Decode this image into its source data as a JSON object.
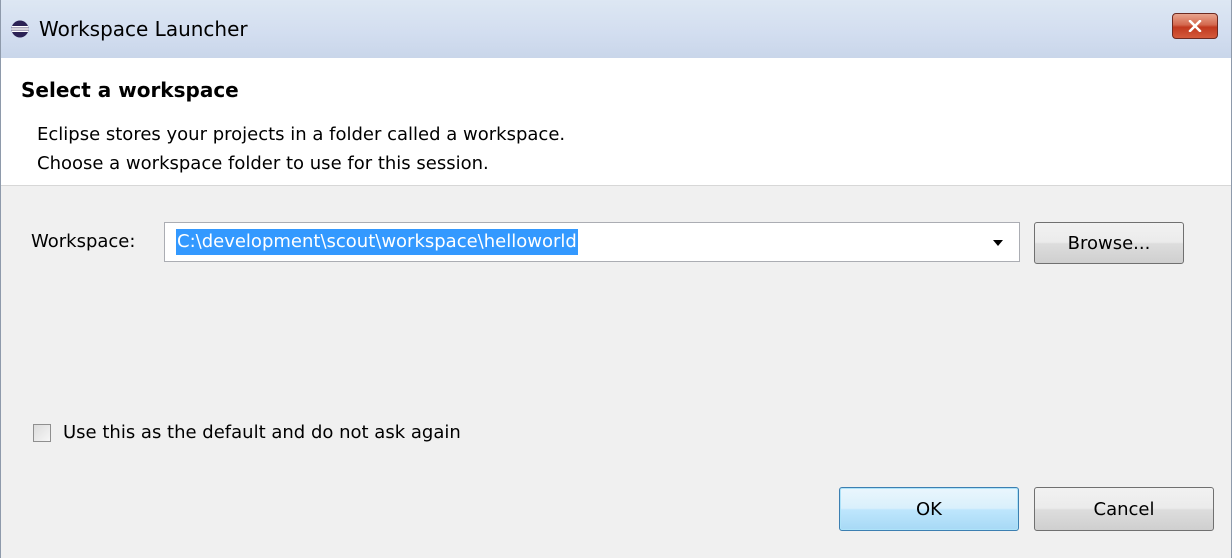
{
  "window": {
    "title": "Workspace Launcher",
    "icon": "eclipse-icon",
    "close_icon": "close-icon"
  },
  "banner": {
    "title": "Select a workspace",
    "line1": "Eclipse stores your projects in a folder called a workspace.",
    "line2": "Choose a workspace folder to use for this session."
  },
  "workspace": {
    "label": "Workspace:",
    "value": "C:\\development\\scout\\workspace\\helloworld",
    "dropdown_icon": "chevron-down-icon",
    "browse_label": "Browse..."
  },
  "default_option": {
    "label": "Use this as the default and do not ask again",
    "checked": false
  },
  "buttons": {
    "ok": "OK",
    "cancel": "Cancel"
  },
  "colors": {
    "selection": "#3399ff",
    "close_button": "#c1391f",
    "default_button_border": "#3c7fb1"
  }
}
